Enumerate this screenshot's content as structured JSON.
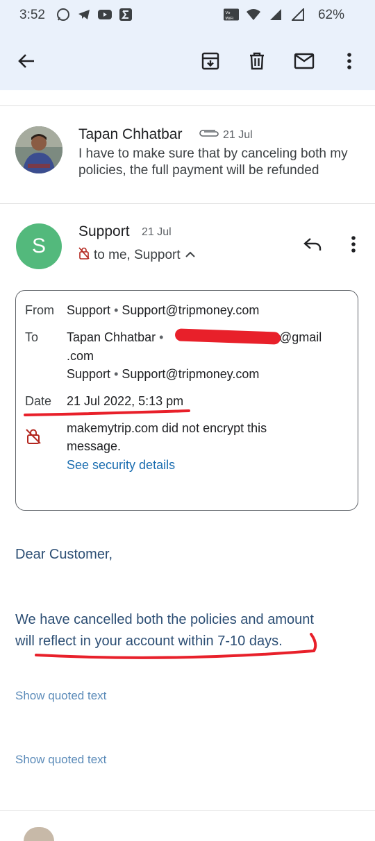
{
  "status_bar": {
    "time": "3:52",
    "battery": "62%",
    "left_icons": [
      "whatsapp-icon",
      "telegram-icon",
      "youtube-icon",
      "sigma-icon"
    ],
    "right_icons": [
      "vowifi-icon",
      "wifi-icon",
      "signal-icon",
      "signal-icon-2"
    ]
  },
  "toolbar": {
    "icons": [
      "back-arrow-icon",
      "archive-icon",
      "delete-icon",
      "mark-unread-icon",
      "more-vert-icon"
    ]
  },
  "thread": {
    "collapsed_message": {
      "sender": "Tapan Chhatbar",
      "date": "21 Jul",
      "snippet": "I have to make sure that by canceling both my policies, the full payment will be refunded"
    },
    "expanded_message": {
      "avatar_letter": "S",
      "sender": "Support",
      "date": "21 Jul",
      "recipients": "to me, Support",
      "details": {
        "from_label": "From",
        "from_name": "Support",
        "from_email": "Support@tripmoney.com",
        "to_label": "To",
        "to_name_1": "Tapan Chhatbar",
        "to_email_1_visible": "@gmail",
        "to_email_1_cont": ".com",
        "to_name_2": "Support",
        "to_email_2": "Support@tripmoney.com",
        "date_label": "Date",
        "date_value": "21 Jul 2022, 5:13 pm",
        "security_line_1": "makemytrip.com did not encrypt this",
        "security_line_2": "message.",
        "security_link": "See security details"
      },
      "body": {
        "greeting": "Dear Customer,",
        "line_1": "We have cancelled both the policies and amount",
        "line_2": "will reflect in your account within 7-10 days."
      },
      "show_quoted_1": "Show quoted text",
      "show_quoted_2": "Show quoted text"
    }
  },
  "colors": {
    "toolbar_bg": "#eaf1fb",
    "avatar_s": "#53b97c",
    "link": "#1a6db0",
    "annotation_red": "#e8202a"
  }
}
